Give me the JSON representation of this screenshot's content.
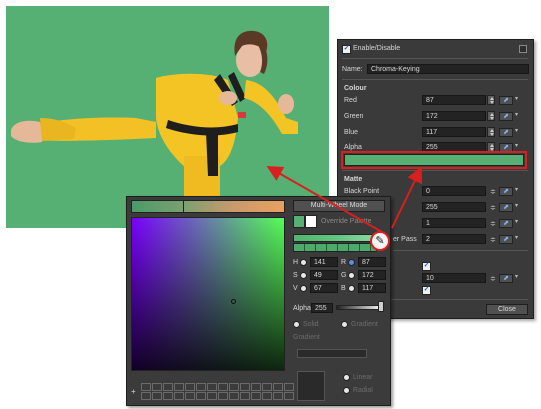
{
  "layer_panel": {
    "enable_label": "Enable/Disable",
    "name_label": "Name:",
    "name_value": "Chroma-Keying",
    "colour_header": "Colour",
    "rows": [
      {
        "label": "Red",
        "value": "87"
      },
      {
        "label": "Green",
        "value": "172"
      },
      {
        "label": "Blue",
        "value": "117"
      },
      {
        "label": "Alpha",
        "value": "255"
      }
    ],
    "key_color": "#57b073",
    "matte_header": "Matte",
    "matte_rows": [
      {
        "label": "Black Point",
        "value": "0"
      },
      {
        "label": "",
        "value": "255"
      },
      {
        "label": "",
        "value": "1"
      },
      {
        "label": "er Pass",
        "value": "2"
      }
    ],
    "extra_value": "10",
    "close_label": "Close"
  },
  "picker": {
    "multiwheel_label": "Multi-Wheel Mode",
    "override_label": "Override Palette",
    "channels": [
      {
        "label": "H",
        "value": "141",
        "label2": "R",
        "value2": "87"
      },
      {
        "label": "S",
        "value": "49",
        "label2": "G",
        "value2": "172"
      },
      {
        "label": "V",
        "value": "67",
        "label2": "B",
        "value2": "117"
      }
    ],
    "alpha_label": "Alpha",
    "alpha_value": "255",
    "radio_solid": "Solid",
    "radio_gradient": "Gradient",
    "gradient_label": "Gradient",
    "radio_linear": "Linear",
    "radio_radial": "Radial",
    "selected_color": "#57b073"
  },
  "annotation": {
    "arrow_color": "#d91f1f"
  }
}
